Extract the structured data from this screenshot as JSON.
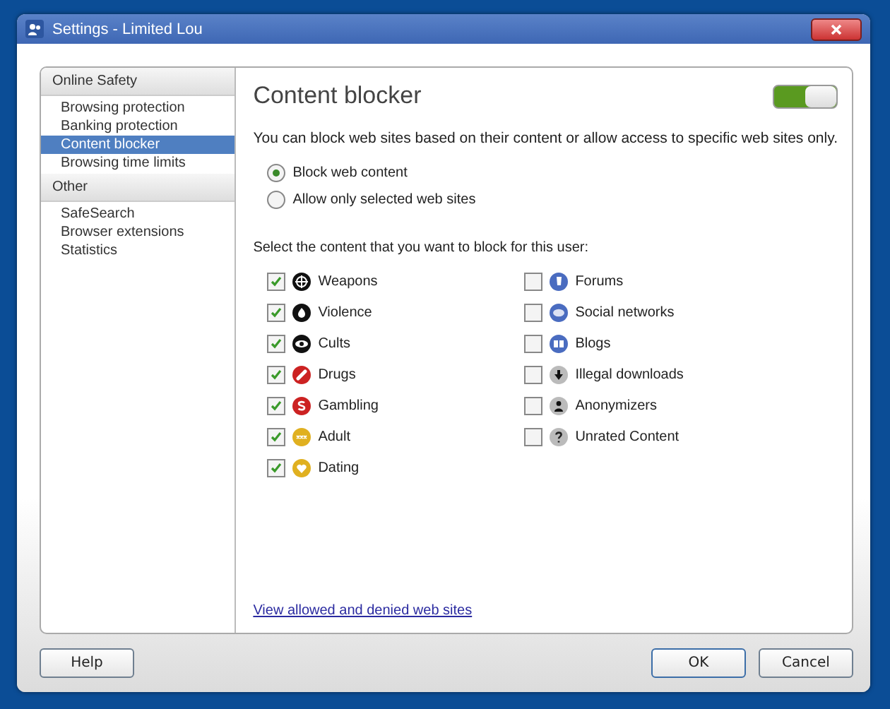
{
  "window": {
    "title": "Settings - Limited Lou"
  },
  "sidebar": {
    "groups": [
      {
        "label": "Online Safety",
        "items": [
          {
            "label": "Browsing protection",
            "selected": false
          },
          {
            "label": "Banking protection",
            "selected": false
          },
          {
            "label": "Content blocker",
            "selected": true
          },
          {
            "label": "Browsing time limits",
            "selected": false
          }
        ]
      },
      {
        "label": "Other",
        "items": [
          {
            "label": "SafeSearch",
            "selected": false
          },
          {
            "label": "Browser extensions",
            "selected": false
          },
          {
            "label": "Statistics",
            "selected": false
          }
        ]
      }
    ]
  },
  "content": {
    "title": "Content blocker",
    "toggle_on": true,
    "description": "You can block web sites based on their content or allow access to specific web sites only.",
    "modes": [
      {
        "label": "Block web content",
        "selected": true
      },
      {
        "label": "Allow only selected web sites",
        "selected": false
      }
    ],
    "prompt": "Select the content that you want to block for this user:",
    "categories_left": [
      {
        "label": "Weapons",
        "checked": true
      },
      {
        "label": "Violence",
        "checked": true
      },
      {
        "label": "Cults",
        "checked": true
      },
      {
        "label": "Drugs",
        "checked": true
      },
      {
        "label": "Gambling",
        "checked": true
      },
      {
        "label": "Adult",
        "checked": true
      },
      {
        "label": "Dating",
        "checked": true
      }
    ],
    "categories_right": [
      {
        "label": "Forums",
        "checked": false
      },
      {
        "label": "Social networks",
        "checked": false
      },
      {
        "label": "Blogs",
        "checked": false
      },
      {
        "label": "Illegal downloads",
        "checked": false
      },
      {
        "label": "Anonymizers",
        "checked": false
      },
      {
        "label": "Unrated Content",
        "checked": false
      }
    ],
    "link": "View allowed and denied web sites"
  },
  "buttons": {
    "help": "Help",
    "ok": "OK",
    "cancel": "Cancel"
  }
}
